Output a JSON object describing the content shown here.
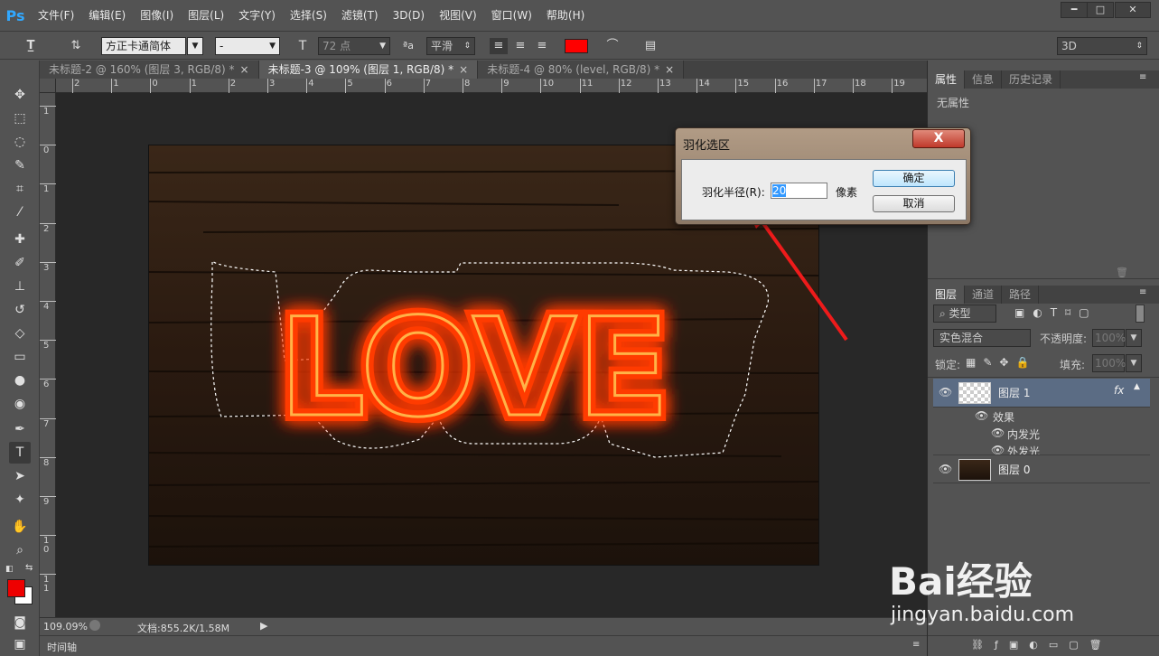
{
  "app": {
    "logo": "Ps"
  },
  "menu": [
    "文件(F)",
    "编辑(E)",
    "图像(I)",
    "图层(L)",
    "文字(Y)",
    "选择(S)",
    "滤镜(T)",
    "3D(D)",
    "视图(V)",
    "窗口(W)",
    "帮助(H)"
  ],
  "window_controls": {
    "minimize": "━",
    "maximize": "□",
    "close": "✕"
  },
  "options": {
    "font_family": "方正卡通简体",
    "font_style": "-",
    "font_size": "72 点",
    "antialias": "平滑",
    "text_color": "#ff0000",
    "workspace": "3D"
  },
  "tabs": [
    {
      "label": "未标题-2 @ 160% (图层 3, RGB/8) *",
      "close": "×"
    },
    {
      "label": "未标题-3 @ 109% (图层 1, RGB/8) *",
      "close": "×"
    },
    {
      "label": "未标题-4 @ 80% (level, RGB/8) *",
      "close": "×"
    }
  ],
  "ruler_h": [
    "2",
    "1",
    "0",
    "1",
    "2",
    "3",
    "4",
    "5",
    "6",
    "7",
    "8",
    "9",
    "10",
    "11",
    "12",
    "13",
    "14",
    "15",
    "16",
    "17",
    "18",
    "19"
  ],
  "ruler_v": [
    "1",
    "0",
    "1",
    "2",
    "3",
    "4",
    "5",
    "6",
    "7",
    "8",
    "9",
    "10",
    "11"
  ],
  "canvas": {
    "text": "LOVE",
    "glow_color": "#ff3b00"
  },
  "status": {
    "zoom": "109.09%",
    "doc": "文档:855.2K/1.58M"
  },
  "timeline": {
    "label": "时间轴"
  },
  "properties_panel": {
    "tabs": [
      "属性",
      "信息",
      "历史记录"
    ],
    "content": "无属性"
  },
  "layers_panel": {
    "tabs": [
      "图层",
      "通道",
      "路径"
    ],
    "filter_kind": "类型",
    "blend_mode": "实色混合",
    "opacity_label": "不透明度:",
    "opacity_value": "100%",
    "lock_label": "锁定:",
    "fill_label": "填充:",
    "fill_value": "100%",
    "layers": [
      {
        "name": "图层 1",
        "fx": "fx",
        "effects_label": "效果",
        "effects": [
          "内发光",
          "外发光"
        ]
      },
      {
        "name": "图层 0"
      }
    ]
  },
  "dialog": {
    "title": "羽化选区",
    "close": "X",
    "feather_label": "羽化半径(R):",
    "feather_value": "20",
    "unit": "像素",
    "ok": "确定",
    "cancel": "取消"
  },
  "watermark": {
    "brand": "Bai经验",
    "url": "jingyan.baidu.com"
  }
}
